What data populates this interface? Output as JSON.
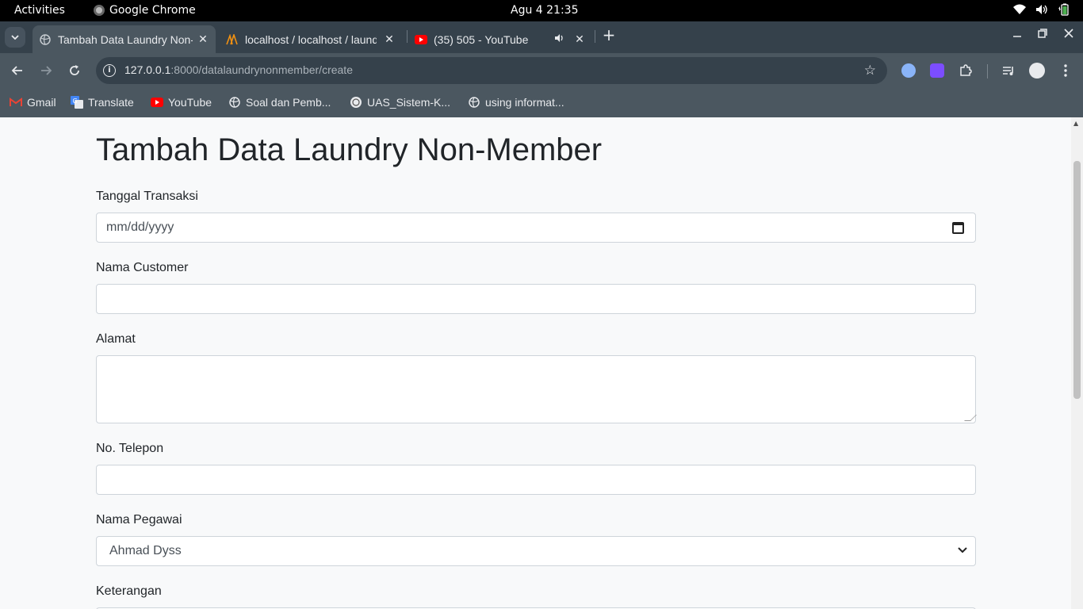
{
  "system": {
    "activities": "Activities",
    "app_name": "Google Chrome",
    "clock": "Agu 4  21:35"
  },
  "tabs": [
    {
      "title": "Tambah Data Laundry Non-Member",
      "active": true
    },
    {
      "title": "localhost / localhost / laundry",
      "active": false
    },
    {
      "title": "(35) 505 - YouTube",
      "active": false
    }
  ],
  "toolbar": {
    "url_host": "127.0.0.1",
    "url_path": ":8000/datalaundrynonmember/create"
  },
  "bookmarks": [
    {
      "label": "Gmail",
      "icon": "gmail-icon"
    },
    {
      "label": "Translate",
      "icon": "translate-icon"
    },
    {
      "label": "YouTube",
      "icon": "youtube-icon"
    },
    {
      "label": "Soal dan Pemb...",
      "icon": "globe-icon"
    },
    {
      "label": "UAS_Sistem-K...",
      "icon": "university-icon"
    },
    {
      "label": "using informat...",
      "icon": "globe-icon"
    }
  ],
  "form": {
    "title": "Tambah Data Laundry Non-Member",
    "tanggal_label": "Tanggal Transaksi",
    "tanggal_placeholder": "mm/dd/yyyy",
    "nama_label": "Nama Customer",
    "nama_value": "",
    "alamat_label": "Alamat",
    "alamat_value": "",
    "telepon_label": "No. Telepon",
    "telepon_value": "",
    "pegawai_label": "Nama Pegawai",
    "pegawai_value": "Ahmad Dyss",
    "keterangan_label": "Keterangan"
  },
  "colors": {
    "tab_strip": "#35414b",
    "toolbar": "#4b5760",
    "page_bg": "#f8f9fa",
    "input_border": "#ced4da"
  }
}
